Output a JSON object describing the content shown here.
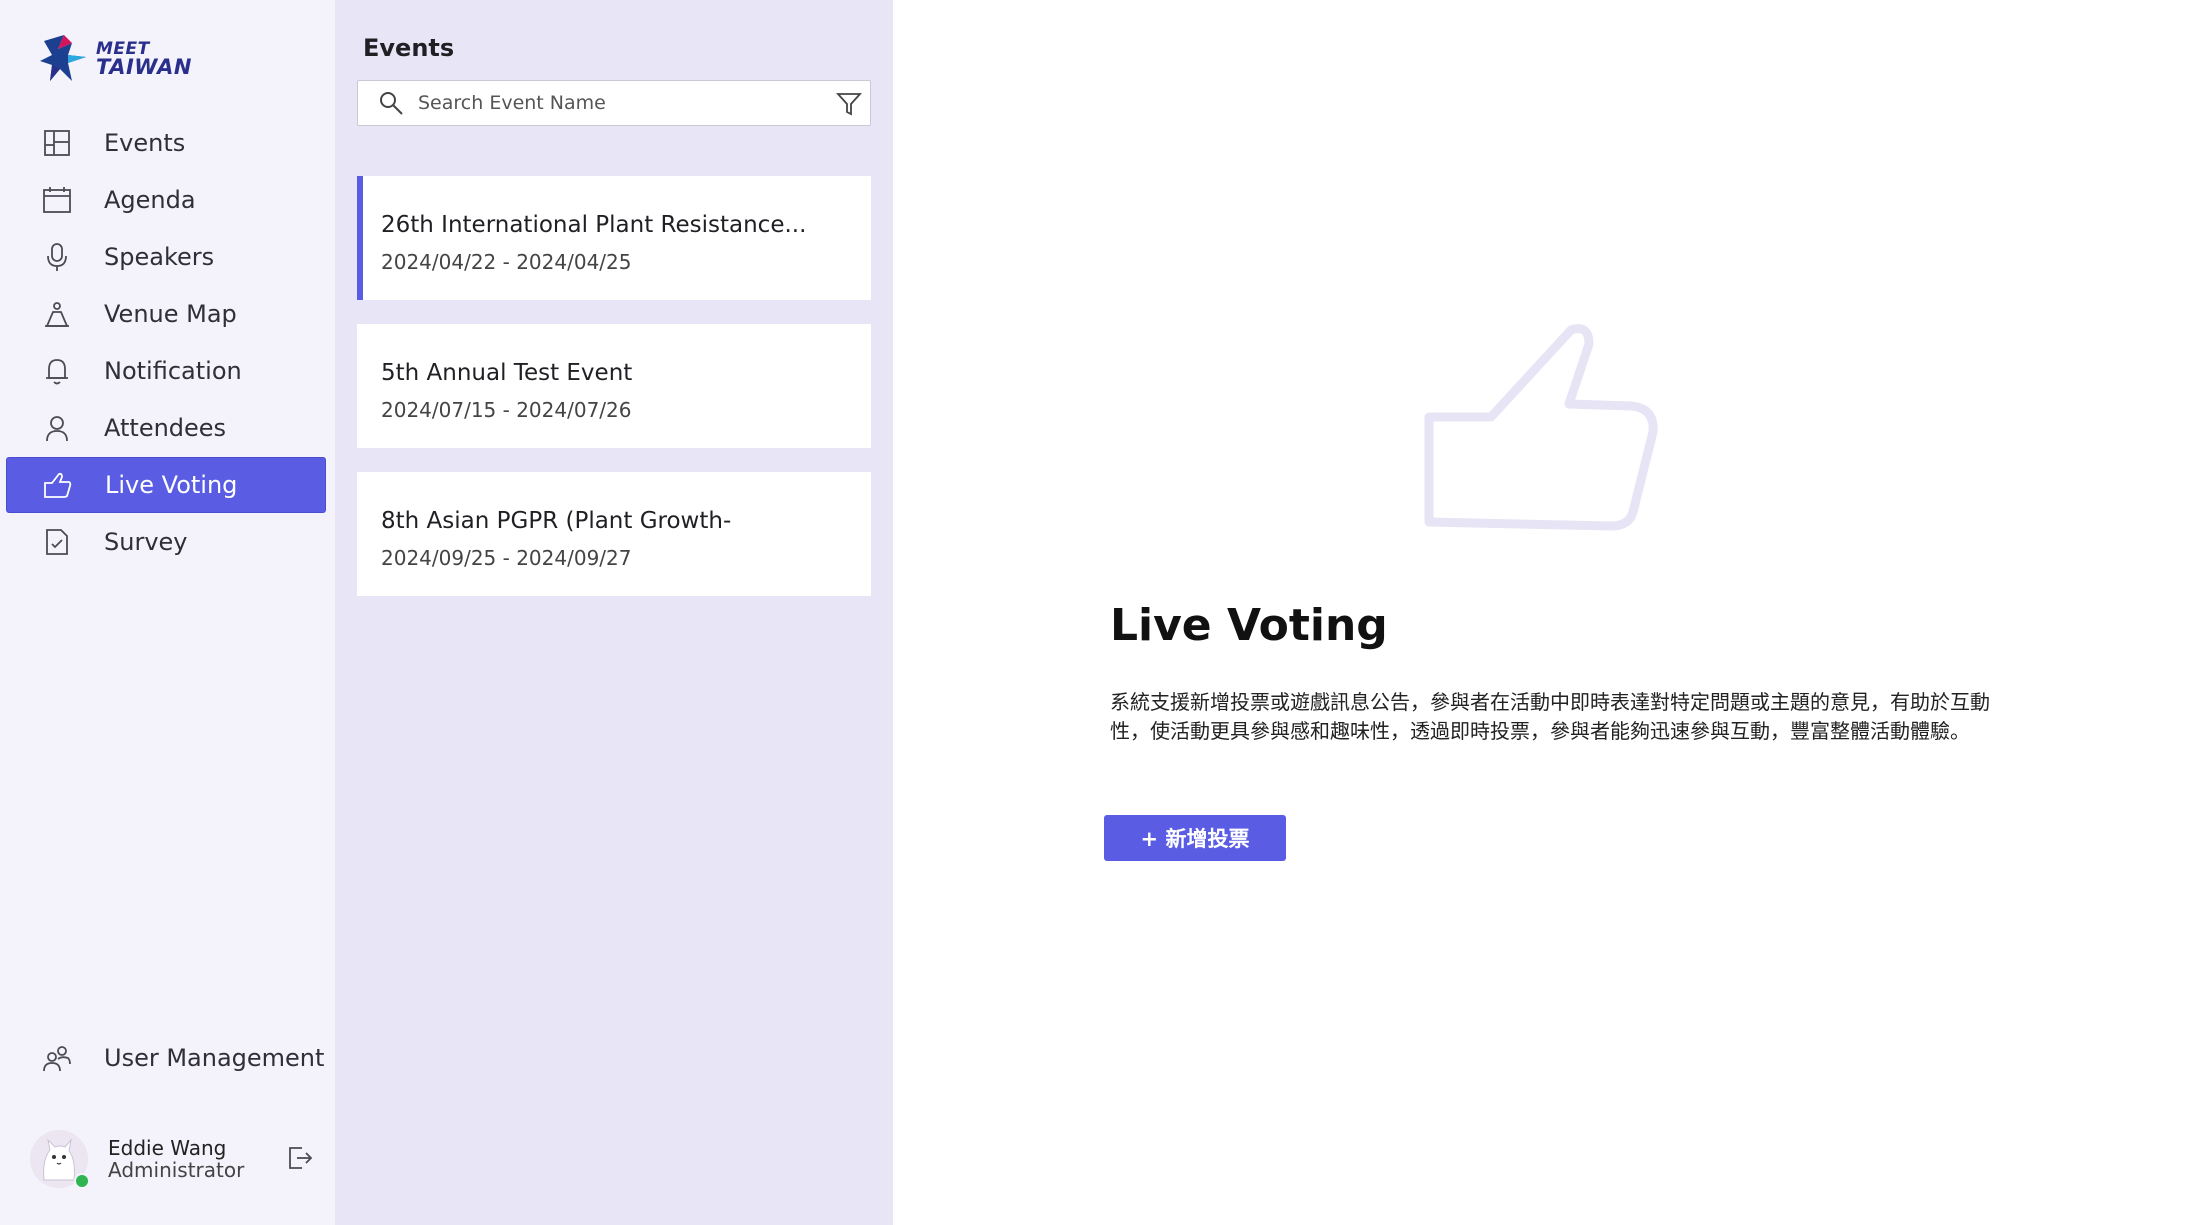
{
  "brand": {
    "line1": "MEET",
    "line2": "TAIWAN"
  },
  "nav": {
    "items": [
      {
        "label": "Events",
        "icon": "layout-icon"
      },
      {
        "label": "Agenda",
        "icon": "calendar-icon"
      },
      {
        "label": "Speakers",
        "icon": "microphone-icon"
      },
      {
        "label": "Venue Map",
        "icon": "map-icon"
      },
      {
        "label": "Notification",
        "icon": "bell-icon"
      },
      {
        "label": "Attendees",
        "icon": "person-icon"
      },
      {
        "label": "Live Voting",
        "icon": "thumb-up-icon",
        "active": true
      },
      {
        "label": "Survey",
        "icon": "survey-icon"
      }
    ],
    "user_management": {
      "label": "User Management",
      "icon": "people-icon"
    }
  },
  "profile": {
    "name": "Eddie Wang",
    "role": "Administrator",
    "status": "online"
  },
  "events_panel": {
    "title": "Events",
    "search_placeholder": "Search Event Name",
    "events": [
      {
        "title": "26th International Plant Resistance...",
        "dates": "2024/04/22 - 2024/04/25",
        "selected": true
      },
      {
        "title": "5th Annual Test Event",
        "dates": "2024/07/15 - 2024/07/26"
      },
      {
        "title": "8th Asian PGPR (Plant Growth-",
        "dates": "2024/09/25 - 2024/09/27"
      }
    ]
  },
  "main": {
    "title": "Live Voting",
    "description": "系統支援新增投票或遊戲訊息公告，參與者在活動中即時表達對特定問題或主題的意見，有助於互動性，使活動更具參與感和趣味性，透過即時投票，參與者能夠迅速參與互動，豐富整體活動體驗。",
    "add_button": "+ 新增投票"
  },
  "colors": {
    "accent": "#5a5de3",
    "nav_bg": "#f4f3fb",
    "events_bg": "#e8e6f6",
    "online": "#2fb44f"
  }
}
